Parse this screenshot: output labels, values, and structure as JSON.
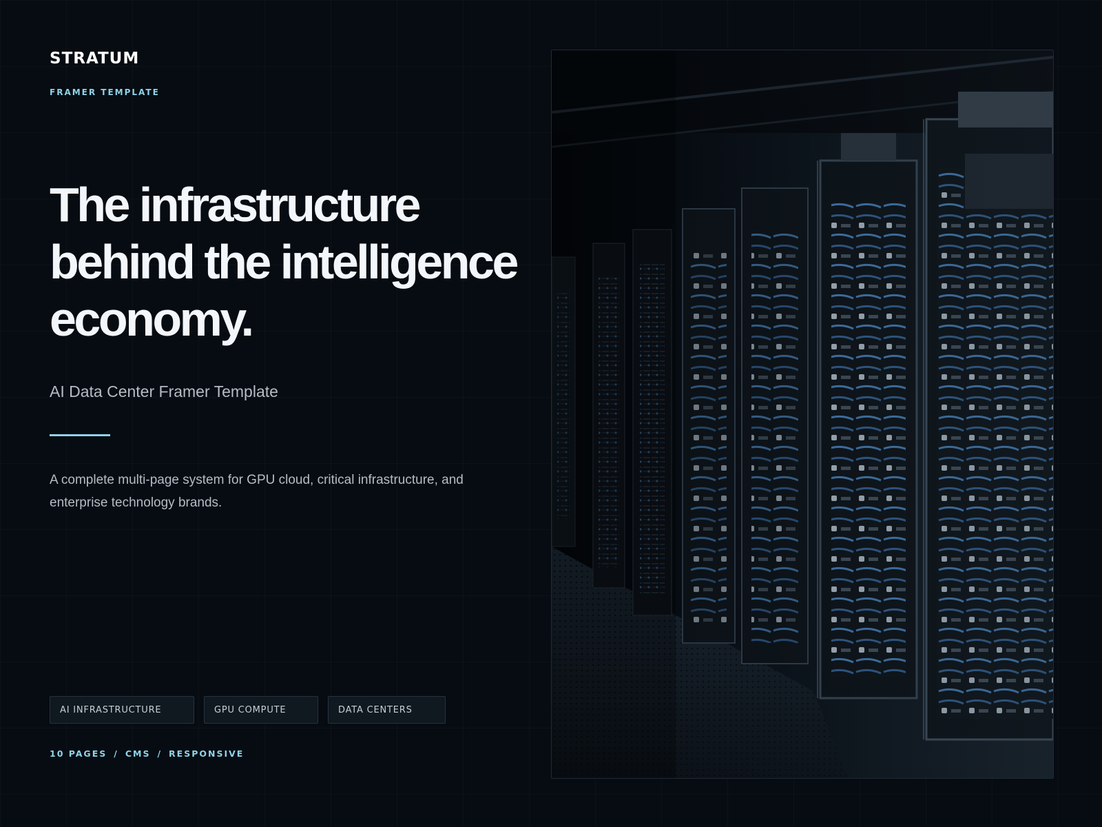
{
  "brand": {
    "name": "STRATUM",
    "kicker": "FRAMER TEMPLATE"
  },
  "hero": {
    "headline_lines": [
      "The infrastructure",
      "behind the intelligence",
      "economy."
    ],
    "subtitle": "AI Data Center Framer Template",
    "description": "A complete multi-page system for GPU cloud, critical infrastructure, and enterprise technology brands."
  },
  "tags": [
    "AI INFRASTRUCTURE",
    "GPU COMPUTE",
    "DATA CENTERS"
  ],
  "meta": {
    "items": [
      "10 PAGES",
      "CMS",
      "RESPONSIVE"
    ],
    "separator": "/"
  },
  "image": {
    "subject": "server-racks-photo"
  },
  "colors": {
    "background": "#070c12",
    "accent": "#8fd3e8",
    "headline": "#f3f6fa",
    "muted_text": "#b4bcc6",
    "tag_background": "#101820",
    "tag_border": "#263340",
    "cable_blue": "#3d6fa0"
  }
}
